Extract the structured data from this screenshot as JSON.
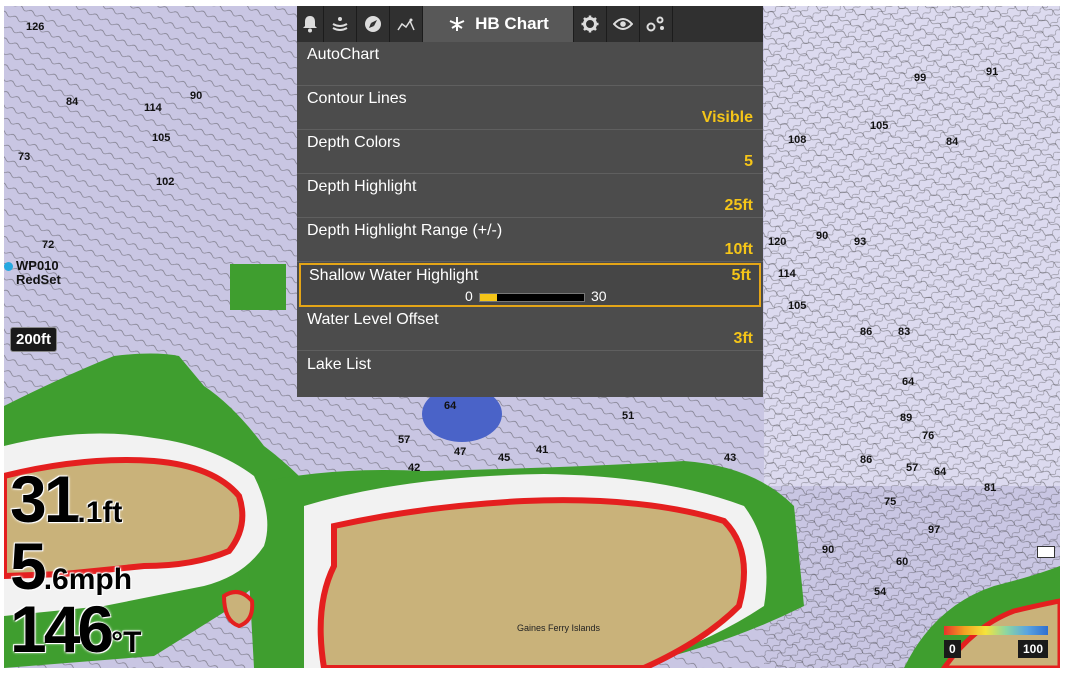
{
  "toolbar": {
    "tabs": [
      {
        "icon": "alarm-bell-icon"
      },
      {
        "icon": "sonar-icon"
      },
      {
        "icon": "navigation-icon"
      },
      {
        "icon": "fish-icon"
      },
      {
        "icon": "hb-chart-icon",
        "label": "HB Chart",
        "active": true
      },
      {
        "icon": "gear-icon"
      },
      {
        "icon": "eye-icon"
      },
      {
        "icon": "network-icon"
      }
    ]
  },
  "menu": {
    "items": [
      {
        "label": "AutoChart",
        "value": ""
      },
      {
        "label": "Contour Lines",
        "value": "Visible"
      },
      {
        "label": "Depth Colors",
        "value": "5"
      },
      {
        "label": "Depth Highlight",
        "value": "25ft"
      },
      {
        "label": "Depth Highlight Range (+/-)",
        "value": "10ft"
      },
      {
        "label": "Shallow Water Highlight",
        "value": "5ft",
        "selected": true,
        "slider": {
          "min": "0",
          "max": "30",
          "value": 5
        }
      },
      {
        "label": "Water Level Offset",
        "value": "3ft"
      },
      {
        "label": "Lake List",
        "value": ""
      }
    ]
  },
  "map": {
    "scale": "200ft",
    "waypoint": {
      "line1": "WP010",
      "line2": "RedSet"
    },
    "island_name": "Gaines Ferry Islands",
    "contour_numbers": [
      "126",
      "84",
      "90",
      "114",
      "105",
      "102",
      "73",
      "72",
      "120",
      "90",
      "93",
      "114",
      "105",
      "51",
      "108",
      "105",
      "84",
      "91",
      "99",
      "86",
      "83",
      "64",
      "89",
      "76",
      "86",
      "57",
      "64",
      "75",
      "97",
      "90",
      "60",
      "54",
      "57",
      "47",
      "42",
      "41",
      "45",
      "43",
      "64",
      "81"
    ]
  },
  "readouts": {
    "depth": {
      "value": "31",
      "unit": ".1ft"
    },
    "speed": {
      "value": "5",
      "unit": ".6mph"
    },
    "heading": {
      "value": "146",
      "unit": "°T"
    }
  },
  "color_scale": {
    "min": "0",
    "max": "100"
  },
  "colors": {
    "water": "#c9c6e3",
    "shallow": "#3f9e2f",
    "land": "#c9b27a",
    "shore": "#e41f1f",
    "highlight": "#f5c518",
    "menu_bg": "#4c4c4c"
  }
}
